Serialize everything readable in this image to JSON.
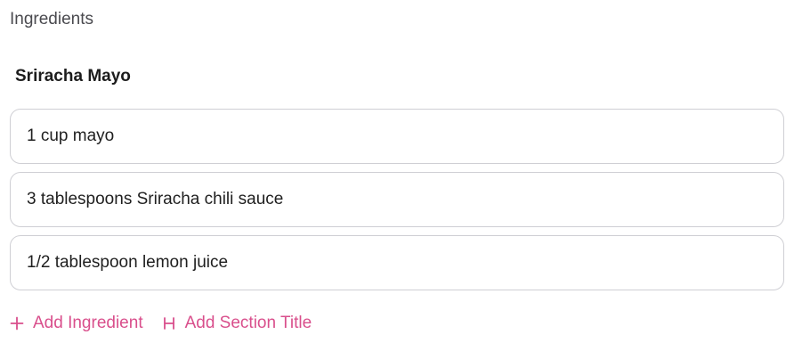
{
  "panel": {
    "label": "Ingredients"
  },
  "section": {
    "title": "Sriracha Mayo"
  },
  "ingredients": [
    {
      "text": "1 cup mayo"
    },
    {
      "text": "3 tablespoons Sriracha chili sauce"
    },
    {
      "text": "1/2 tablespoon lemon juice"
    }
  ],
  "actions": {
    "add_ingredient": {
      "label": "Add Ingredient",
      "icon": "plus-icon"
    },
    "add_section_title": {
      "label": "Add Section Title",
      "icon": "heading-icon"
    }
  },
  "colors": {
    "accent": "#d94f8c",
    "border": "#cfcfd4",
    "muted_text": "#4a4a4f"
  }
}
